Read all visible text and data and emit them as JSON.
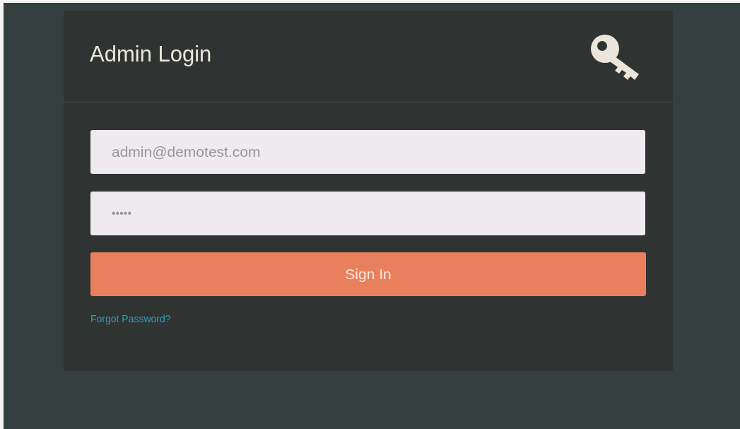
{
  "title": "Admin Login",
  "fields": [
    {
      "kind": "email",
      "value": "admin@demotest.com"
    },
    {
      "kind": "password",
      "value": "•••••"
    }
  ],
  "button": "Sign In",
  "link": "Forgot Password?"
}
